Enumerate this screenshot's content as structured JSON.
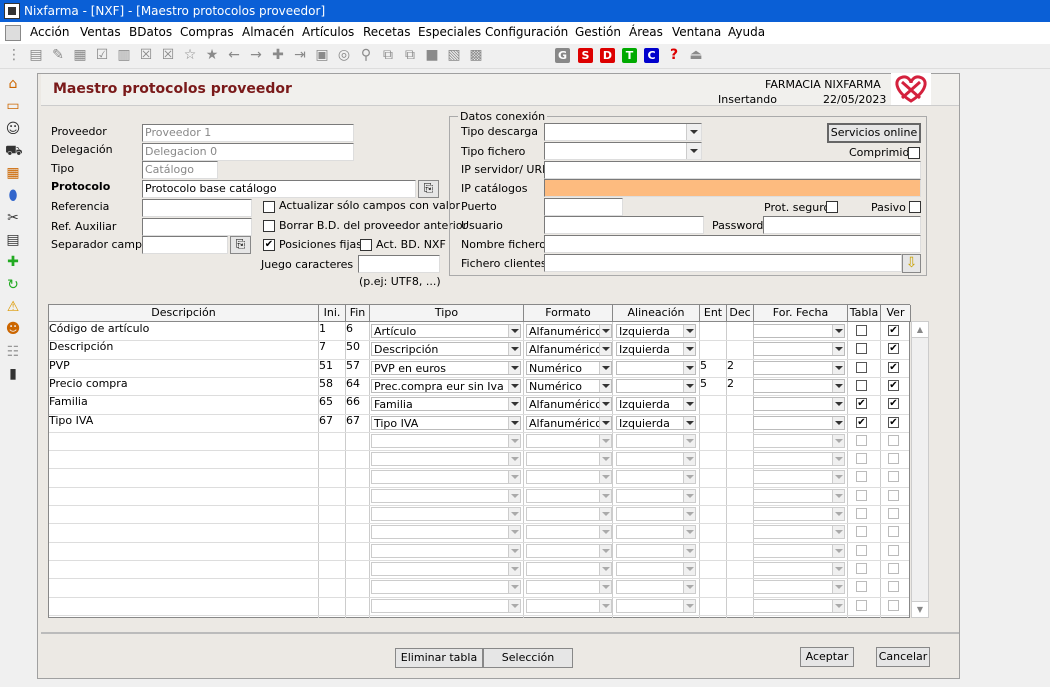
{
  "window": {
    "title": "Nixfarma - [NXF] - [Maestro protocolos proveedor]"
  },
  "menu": [
    "Acción",
    "Ventas",
    "BDatos",
    "Compras",
    "Almacén",
    "Artículos",
    "Recetas",
    "Especiales",
    "Configuración",
    "Gestión",
    "Áreas",
    "Ventana",
    "Ayuda"
  ],
  "toolbar_letters": [
    {
      "t": "G",
      "c": "#888"
    },
    {
      "t": "S",
      "c": "#d00"
    },
    {
      "t": "D",
      "c": "#d00"
    },
    {
      "t": "T",
      "c": "#0a0"
    },
    {
      "t": "C",
      "c": "#00c"
    }
  ],
  "header": {
    "title": "Maestro protocolos proveedor",
    "pharmacy": "FARMACIA NIXFARMA",
    "mode": "Insertando",
    "date": "22/05/2023"
  },
  "form": {
    "proveedor_label": "Proveedor",
    "proveedor_value": "Proveedor 1",
    "delegacion_label": "Delegación",
    "delegacion_value": "Delegacion 0",
    "tipo_label": "Tipo",
    "tipo_value": "Catálogo",
    "protocolo_label": "Protocolo",
    "protocolo_value": "Protocolo base catálogo",
    "referencia_label": "Referencia",
    "refaux_label": "Ref. Auxiliar",
    "separador_label": "Separador campos",
    "cb_actualizar": "Actualizar sólo campos con valor",
    "cb_borrar": "Borrar B.D. del proveedor anterior",
    "cb_posiciones": "Posiciones fijas",
    "cb_actbd": "Act. BD. NXF",
    "juego_label": "Juego caracteres",
    "juego_hint": "(p.ej: UTF8, ...)"
  },
  "conexion": {
    "group_label": "Datos conexión",
    "tipo_descarga": "Tipo descarga",
    "tipo_fichero": "Tipo fichero",
    "servicios": "Servicios online",
    "comprimido": "Comprimido",
    "ip_servidor": "IP servidor/ URL",
    "ip_catalogos": "IP catálogos",
    "puerto": "Puerto",
    "prot_seguro": "Prot. seguro",
    "pasivo": "Pasivo",
    "usuario": "Usuario",
    "password": "Password",
    "nombre_fichero": "Nombre fichero",
    "fichero_clientes": "Fichero clientes"
  },
  "grid": {
    "headers": [
      "Descripción",
      "Ini.",
      "Fin",
      "Tipo",
      "Formato",
      "Alineación",
      "Ent",
      "Dec",
      "For. Fecha",
      "Tabla",
      "Ver"
    ],
    "rows": [
      {
        "desc": "Código de artículo",
        "ini": "1",
        "fin": "6",
        "tipo": "Artículo",
        "formato": "Alfanumérico",
        "alin": "Izquierda",
        "ent": "",
        "dec": "",
        "tabla": false,
        "ver": true
      },
      {
        "desc": "Descripción",
        "ini": "7",
        "fin": "50",
        "tipo": "Descripción",
        "formato": "Alfanumérico",
        "alin": "Izquierda",
        "ent": "",
        "dec": "",
        "tabla": false,
        "ver": true
      },
      {
        "desc": "PVP",
        "ini": "51",
        "fin": "57",
        "tipo": "PVP  en euros",
        "formato": "Numérico",
        "alin": "",
        "ent": "5",
        "dec": "2",
        "tabla": false,
        "ver": true
      },
      {
        "desc": "Precio compra",
        "ini": "58",
        "fin": "64",
        "tipo": "Prec.compra eur sin Iva",
        "formato": "Numérico",
        "alin": "",
        "ent": "5",
        "dec": "2",
        "tabla": false,
        "ver": true
      },
      {
        "desc": "Familia",
        "ini": "65",
        "fin": "66",
        "tipo": "Familia",
        "formato": "Alfanumérico",
        "alin": "Izquierda",
        "ent": "",
        "dec": "",
        "tabla": true,
        "ver": true
      },
      {
        "desc": "Tipo IVA",
        "ini": "67",
        "fin": "67",
        "tipo": "Tipo IVA",
        "formato": "Alfanumérico",
        "alin": "Izquierda",
        "ent": "",
        "dec": "",
        "tabla": true,
        "ver": true
      }
    ]
  },
  "buttons": {
    "eliminar": "Eliminar tabla",
    "seleccion": "Selección",
    "aceptar": "Aceptar",
    "cancelar": "Cancelar"
  },
  "colors": {
    "titlebar": "#0a5fd6",
    "ip_catalogos_bg": "#fdbb7f",
    "title_text": "#7a1a1a",
    "logo": "#d4213d"
  }
}
